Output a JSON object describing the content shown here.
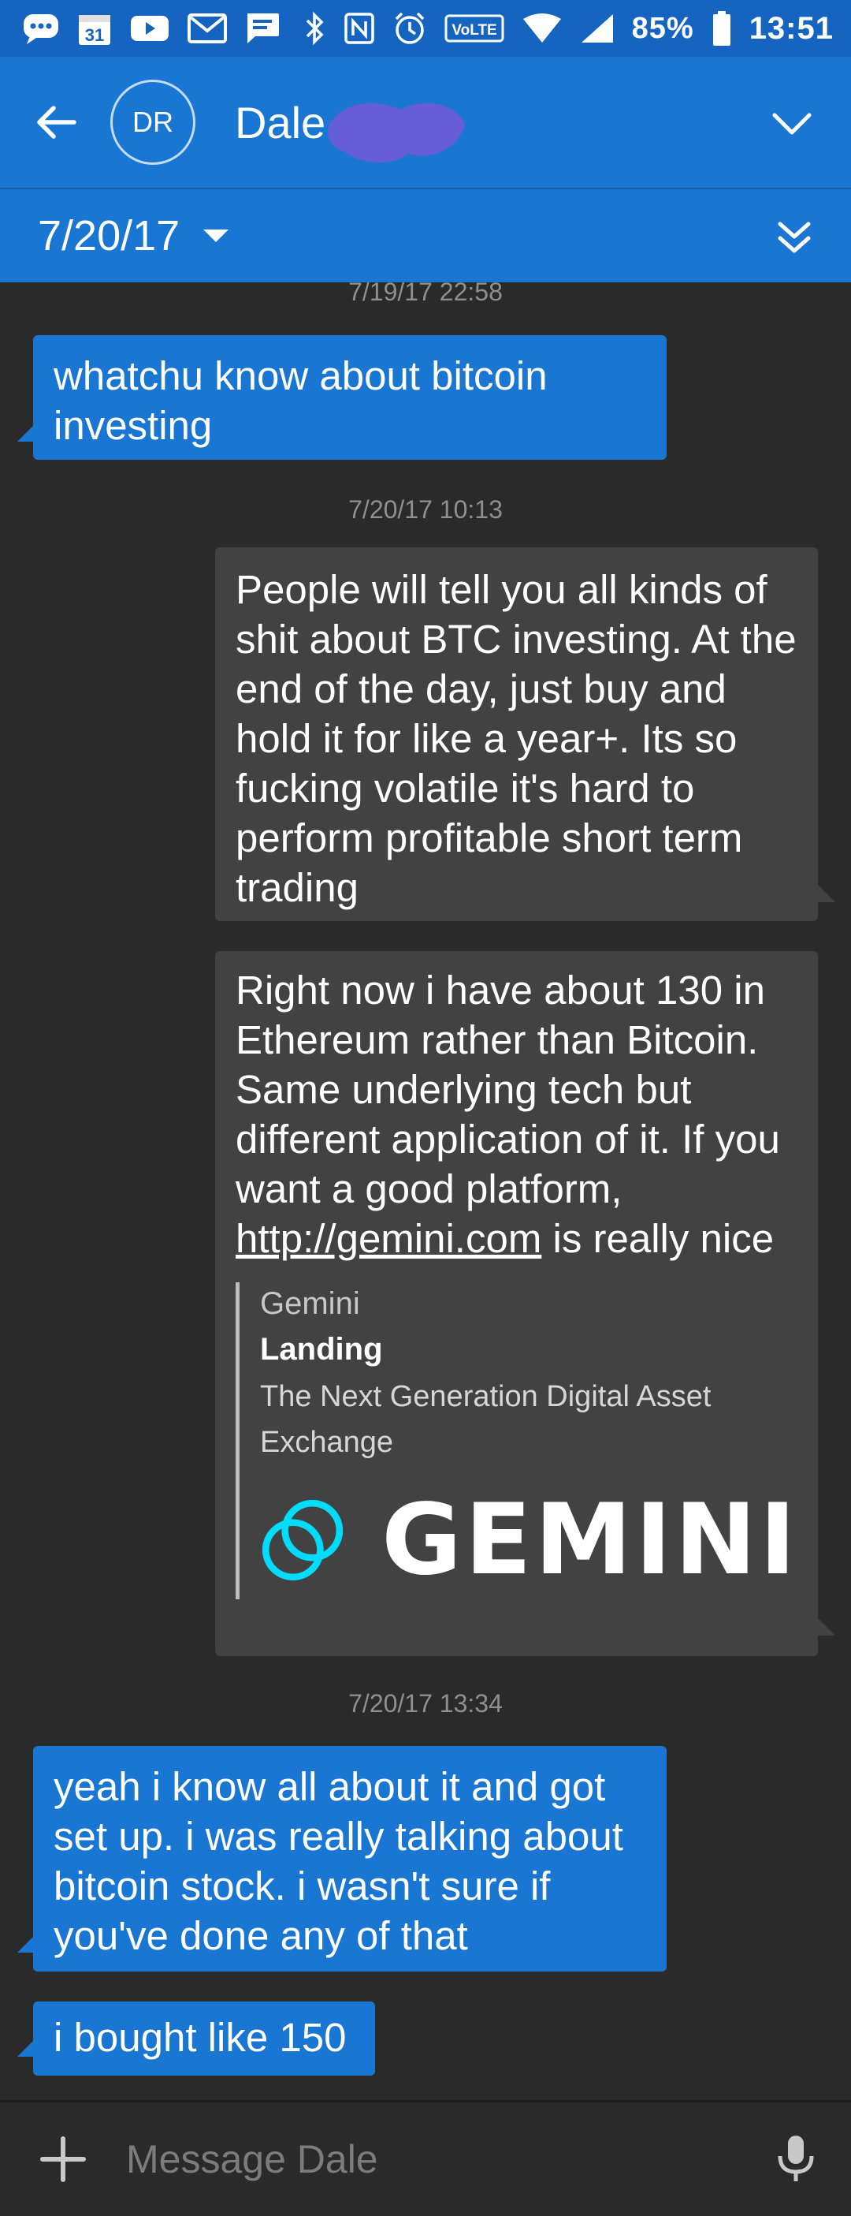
{
  "status_bar": {
    "battery_percent": "85%",
    "time": "13:51",
    "network_badge": "VoLTE",
    "calendar_date": "31"
  },
  "header": {
    "avatar_initials": "DR",
    "contact_name": "Dale"
  },
  "date_bar": {
    "selected_date": "7/20/17"
  },
  "messages": {
    "ts1": "7/19/17 22:58",
    "m1": "whatchu know about bitcoin investing",
    "ts2": "7/20/17 10:13",
    "m2": "People will tell you all kinds of shit about BTC investing. At the end of the day, just buy and hold it for like a year+. Its so fucking volatile it's hard to perform profitable short term trading",
    "m3_text": "Right now i have about 130 in Ethereum rather than Bitcoin. Same underlying tech but different application of it. If you want a good platform,",
    "m3_link": "http://gemini.com",
    "m3_after": "is really nice",
    "preview_site": "Gemini",
    "preview_title": "Landing",
    "preview_desc": "The Next Generation Digital Asset Exchange",
    "logo_word": "GEMINI",
    "ts3": "7/20/17 13:34",
    "m4": "yeah i know all about it and got set up. i was really talking about bitcoin stock. i wasn't sure if you've done any of that",
    "m5": "i bought like 150"
  },
  "composer": {
    "placeholder": "Message Dale"
  },
  "colors": {
    "app_bar": "#1976d2",
    "status_bar": "#1565c0",
    "incoming_bubble": "#1976d2",
    "outgoing_bubble": "#424242",
    "background": "#2a2a2a",
    "logo_accent": "#00dcfa"
  },
  "icons": {
    "back": "arrow-left-icon",
    "expand_header": "chevron-down-icon",
    "expand_date": "double-chevron-down-icon",
    "add": "plus-icon",
    "mic": "microphone-icon"
  }
}
